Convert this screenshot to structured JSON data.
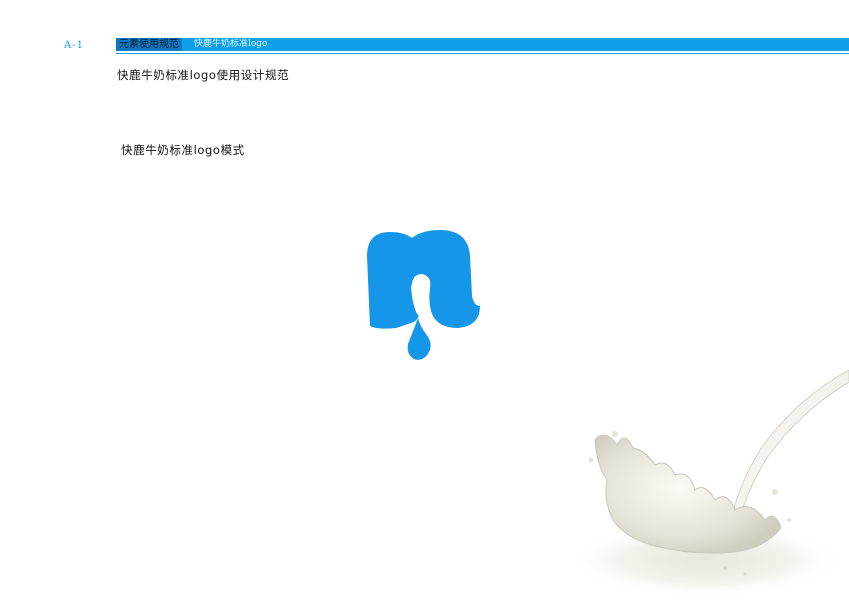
{
  "header": {
    "page_code": "A-1",
    "section_label": "元素使用规范",
    "subsection_label": "快鹿牛奶标准logo"
  },
  "content": {
    "document_title": "快鹿牛奶标准logo使用设计规范",
    "mode_title": "快鹿牛奶标准logo模式"
  },
  "colors": {
    "brand_blue": "#0ea0e6",
    "logo_blue": "#1596e8"
  },
  "icons": {
    "logo": "milk-drop-n-logo",
    "decoration": "milk-splash-image"
  }
}
